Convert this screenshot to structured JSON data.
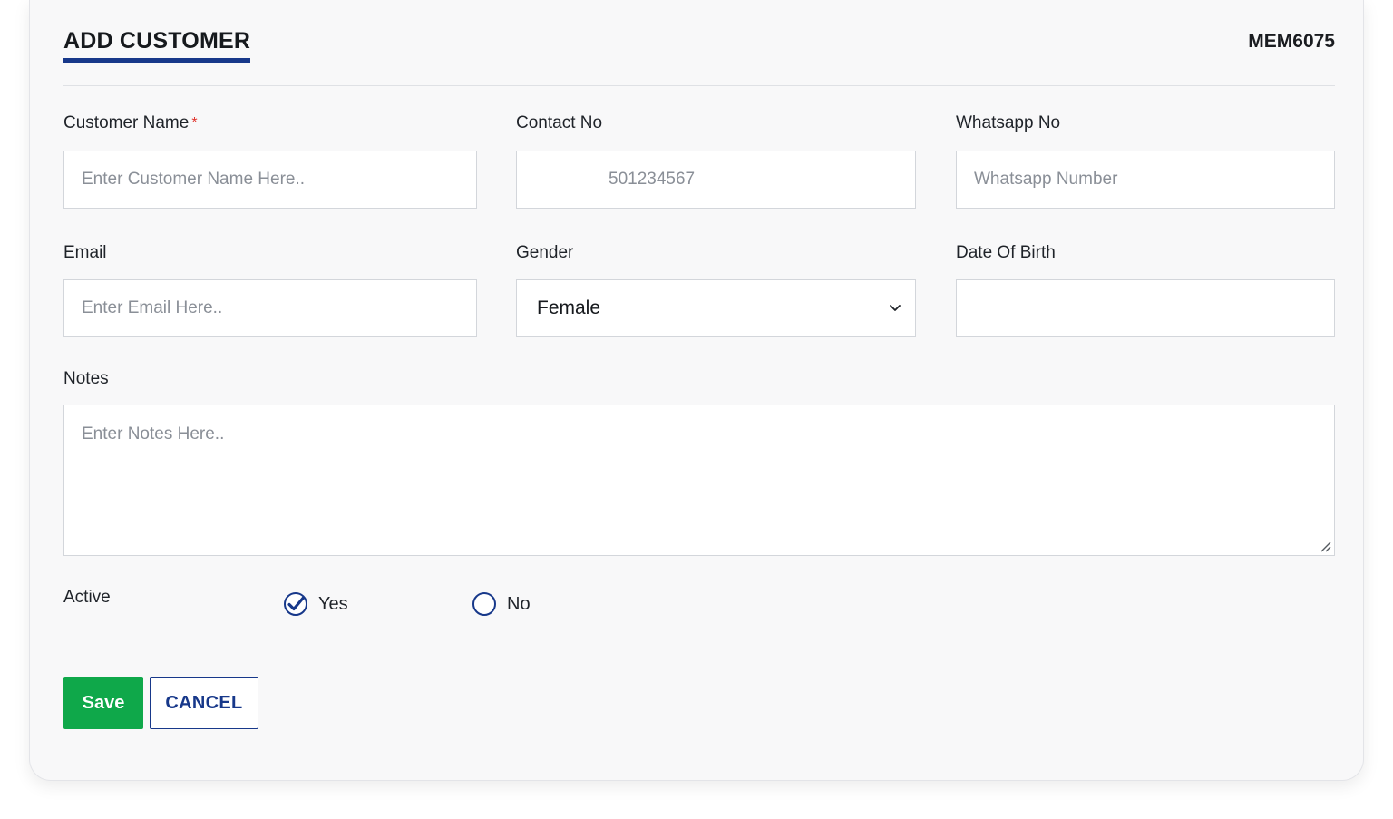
{
  "header": {
    "title": "ADD CUSTOMER",
    "member_id": "MEM6075"
  },
  "form": {
    "customer_name": {
      "label": "Customer Name",
      "required_mark": "*",
      "placeholder": "Enter Customer Name Here..",
      "value": ""
    },
    "contact_no": {
      "label": "Contact No",
      "country_code": "",
      "placeholder": "501234567",
      "value": ""
    },
    "whatsapp_no": {
      "label": "Whatsapp No",
      "placeholder": "Whatsapp Number",
      "value": ""
    },
    "email": {
      "label": "Email",
      "placeholder": "Enter Email Here..",
      "value": ""
    },
    "gender": {
      "label": "Gender",
      "selected": "Female"
    },
    "date_of_birth": {
      "label": "Date Of Birth",
      "value": ""
    },
    "notes": {
      "label": "Notes",
      "placeholder": "Enter Notes Here..",
      "value": ""
    },
    "active": {
      "label": "Active",
      "options": [
        {
          "label": "Yes",
          "checked": true
        },
        {
          "label": "No",
          "checked": false
        }
      ]
    }
  },
  "actions": {
    "save_label": "Save",
    "cancel_label": "CANCEL"
  },
  "colors": {
    "accent": "#17388a",
    "save_green": "#0fa84a",
    "required_red": "#e0342d"
  }
}
